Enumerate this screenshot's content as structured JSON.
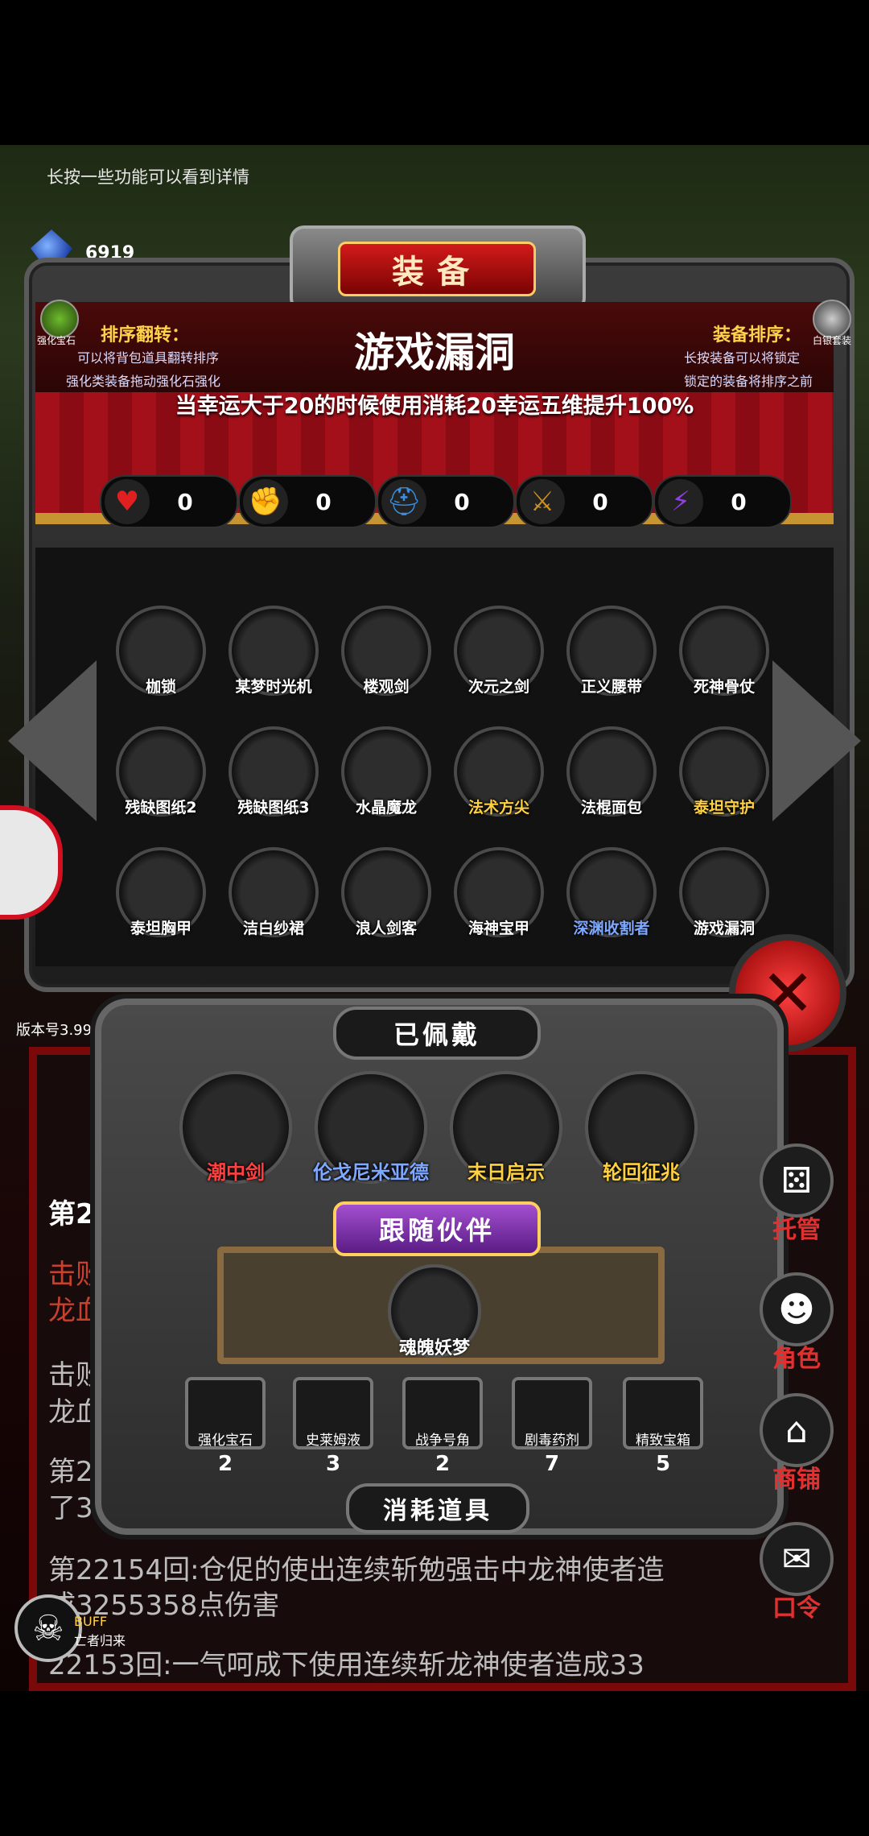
{
  "hint": "长按一些功能可以看到详情",
  "gem": {
    "label": "宝石",
    "count": "6919"
  },
  "panel": {
    "title": "装备",
    "left_icon_label": "强化宝石",
    "right_icon_label": "白银套装",
    "sort_flip_title": "排序翻转：",
    "sort_flip_line1": "可以将背包道具翻转排序",
    "sort_flip_line2": "强化类装备拖动强化石强化",
    "sort_equip_title": "装备排序：",
    "sort_equip_line1": "长按装备可以将锁定",
    "sort_equip_line2": "锁定的装备将排序之前",
    "item_name": "游戏漏洞",
    "item_desc": "当幸运大于20的时候使用消耗20幸运五维提升100%"
  },
  "stats": [
    {
      "icon": "heart-icon",
      "glyph": "♥",
      "color": "#e02020",
      "value": "0"
    },
    {
      "icon": "strength-icon",
      "glyph": "✊",
      "color": "#f0c020",
      "value": "0"
    },
    {
      "icon": "helmet-icon",
      "glyph": "⛑",
      "color": "#3a8ee0",
      "value": "0"
    },
    {
      "icon": "sword-icon",
      "glyph": "⚔",
      "color": "#d09020",
      "value": "0"
    },
    {
      "icon": "lightning-icon",
      "glyph": "⚡",
      "color": "#9040e0",
      "value": "0"
    }
  ],
  "inventory": [
    {
      "name": "枷锁",
      "color": "#ffffff"
    },
    {
      "name": "某梦时光机",
      "color": "#ffffff"
    },
    {
      "name": "楼观剑",
      "color": "#ffffff"
    },
    {
      "name": "次元之剑",
      "color": "#ffffff"
    },
    {
      "name": "正义腰带",
      "color": "#ffffff"
    },
    {
      "name": "死神骨仗",
      "color": "#ffffff"
    },
    {
      "name": "残缺图纸2",
      "color": "#ffffff"
    },
    {
      "name": "残缺图纸3",
      "color": "#ffffff"
    },
    {
      "name": "水晶魔龙",
      "color": "#ffffff"
    },
    {
      "name": "法术方尖",
      "color": "#ffd040"
    },
    {
      "name": "法棍面包",
      "color": "#ffffff"
    },
    {
      "name": "泰坦守护",
      "color": "#ffd040"
    },
    {
      "name": "泰坦胸甲",
      "color": "#ffffff"
    },
    {
      "name": "洁白纱裙",
      "color": "#ffffff"
    },
    {
      "name": "浪人剑客",
      "color": "#ffffff"
    },
    {
      "name": "海神宝甲",
      "color": "#ffffff"
    },
    {
      "name": "深渊收割者",
      "color": "#7fa8ff"
    },
    {
      "name": "游戏漏洞",
      "color": "#ffffff"
    }
  ],
  "version": "版本号3.99",
  "equipped": {
    "title": "已佩戴",
    "items": [
      {
        "name": "潮中剑",
        "color": "#ff4040"
      },
      {
        "name": "伦戈尼米亚德",
        "color": "#7fa8ff"
      },
      {
        "name": "末日启示",
        "color": "#ffd040"
      },
      {
        "name": "轮回征兆",
        "color": "#ffd040"
      }
    ]
  },
  "partner": {
    "title": "跟随伙伴",
    "name": "魂魄妖梦"
  },
  "consumables": {
    "title": "消耗道具",
    "items": [
      {
        "name": "强化宝石",
        "count": "2"
      },
      {
        "name": "史莱姆液",
        "count": "3"
      },
      {
        "name": "战争号角",
        "count": "2"
      },
      {
        "name": "剧毒药剂",
        "count": "7"
      },
      {
        "name": "精致宝箱",
        "count": "5"
      }
    ]
  },
  "side_buttons": [
    {
      "label": "托管",
      "icon": "dice-icon",
      "glyph": "⚄"
    },
    {
      "label": "角色",
      "icon": "hood-icon",
      "glyph": "☻"
    },
    {
      "label": "商铺",
      "icon": "shop-icon",
      "glyph": "⌂"
    },
    {
      "label": "口令",
      "icon": "scroll-icon",
      "glyph": "✉"
    }
  ],
  "log": {
    "line1_prefix": "第2",
    "line2": "击败",
    "line3": "龙血",
    "line4": "击败",
    "line5": "龙血",
    "line6": "第2",
    "line7": "了3",
    "line8": "第22154回:仓促的使出连续斩勉强击中龙神使者造",
    "line9": "成3255358点伤害",
    "line10": "22153回:一气呵成下使用连续斩龙神使者造成33"
  },
  "buff": {
    "label": "BUFF",
    "sub": "亡者归来"
  }
}
